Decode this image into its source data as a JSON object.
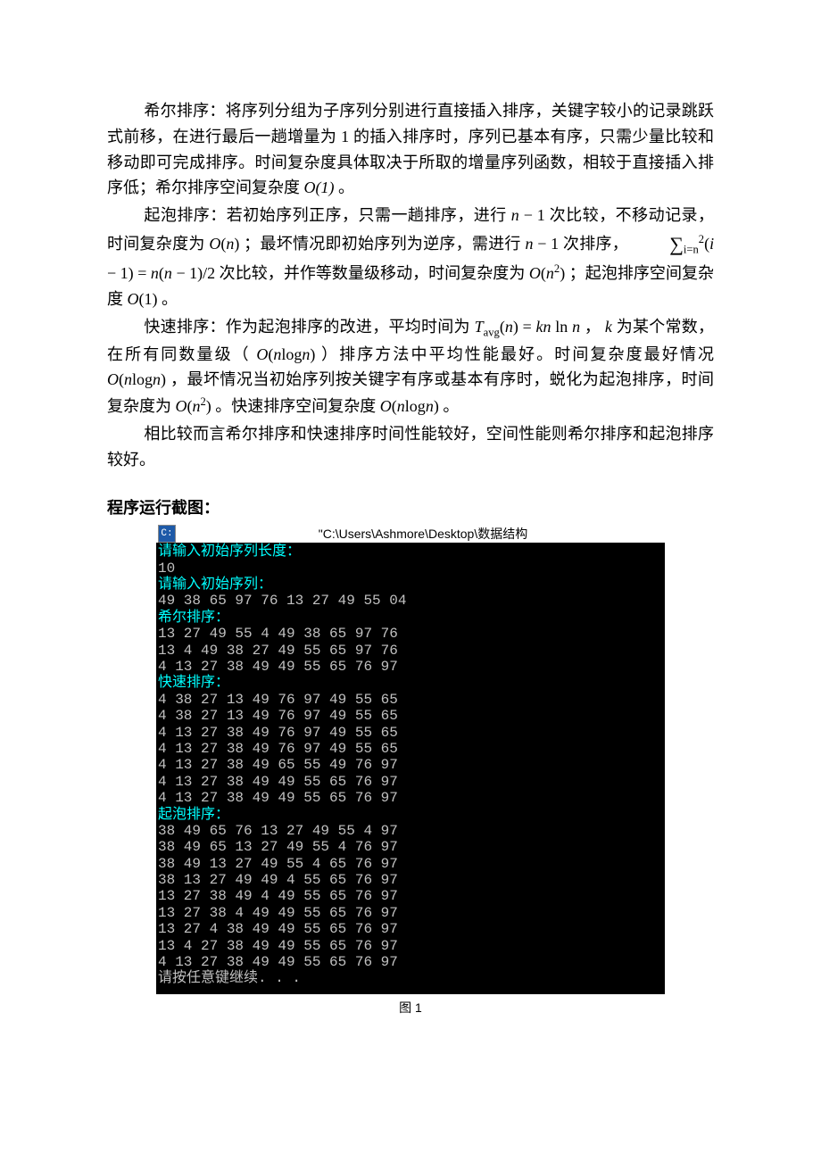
{
  "para1_a": "希尔排序：将序列分组为子序列分别进行直接插入排序，关键字较小的记录跳跃式前移，在进行最后一趟增量为 1 的插入排序时，序列已基本有序，只需少量比较和移动即可完成排序。时间复杂度具体取决于所取的增量序列函数，相较于直接插入排序低；希尔排序空间复杂度",
  "para1_b": "。",
  "para2_a": "起泡排序：若初始序列正序，只需一趟排序，进行",
  "para2_b": "次比较，不移动记录，时间复杂度为",
  "para2_c": "；最坏情况即初始序列为逆序，需进行",
  "para2_d": "次排序，",
  "para2_e": "次比较，并作等数量级移动，时间复杂度为",
  "para2_f": "；起泡排序空间复杂度",
  "para2_g": "。",
  "para3_a": "快速排序：作为起泡排序的改进，平均时间为",
  "para3_b": "，",
  "para3_c": " 为某个常数，在所有同数量级（",
  "para3_d": "）排序方法中平均性能最好。时间复杂度最好情况",
  "para3_e": "，最坏情况当初始序列按关键字有序或基本有序时，蜕化为起泡排序，时间复杂度为",
  "para3_f": "。快速排序空间复杂度",
  "para3_g": "。",
  "para4": "相比较而言希尔排序和快速排序时间性能较好，空间性能则希尔排序和起泡排序较好。",
  "section_label": "程序运行截图：",
  "caption": "图  1",
  "formula": {
    "O1": "O(1)",
    "n_minus_1": "n − 1",
    "On": "O(n)",
    "sum_expr": "(i − 1) = n(n − 1)/2",
    "sum_upper": "2",
    "sum_lower": "i=n",
    "On2": "O(n²)",
    "Tavg": "Tₐᵥg(n) = kn ln n",
    "k": "k",
    "Onlogn": "O(n log n)"
  },
  "console": {
    "title": "\"C:\\Users\\Ashmore\\Desktop\\数据结构",
    "lines": [
      {
        "t": "请输入初始序列长度：",
        "c": "cyan"
      },
      {
        "t": "10",
        "c": ""
      },
      {
        "t": "请输入初始序列：",
        "c": "cyan"
      },
      {
        "t": "49 38 65 97 76 13 27 49 55 04",
        "c": ""
      },
      {
        "t": "希尔排序：",
        "c": "cyan"
      },
      {
        "t": "13 27 49 55 4 49 38 65 97 76",
        "c": ""
      },
      {
        "t": "13 4 49 38 27 49 55 65 97 76",
        "c": ""
      },
      {
        "t": "4 13 27 38 49 49 55 65 76 97",
        "c": ""
      },
      {
        "t": "快速排序：",
        "c": "cyan"
      },
      {
        "t": "4 38 27 13 49 76 97 49 55 65",
        "c": ""
      },
      {
        "t": "4 38 27 13 49 76 97 49 55 65",
        "c": ""
      },
      {
        "t": "4 13 27 38 49 76 97 49 55 65",
        "c": ""
      },
      {
        "t": "4 13 27 38 49 76 97 49 55 65",
        "c": ""
      },
      {
        "t": "4 13 27 38 49 65 55 49 76 97",
        "c": ""
      },
      {
        "t": "4 13 27 38 49 49 55 65 76 97",
        "c": ""
      },
      {
        "t": "4 13 27 38 49 49 55 65 76 97",
        "c": ""
      },
      {
        "t": "起泡排序：",
        "c": "cyan"
      },
      {
        "t": "38 49 65 76 13 27 49 55 4 97",
        "c": ""
      },
      {
        "t": "38 49 65 13 27 49 55 4 76 97",
        "c": ""
      },
      {
        "t": "38 49 13 27 49 55 4 65 76 97",
        "c": ""
      },
      {
        "t": "38 13 27 49 49 4 55 65 76 97",
        "c": ""
      },
      {
        "t": "13 27 38 49 4 49 55 65 76 97",
        "c": ""
      },
      {
        "t": "13 27 38 4 49 49 55 65 76 97",
        "c": ""
      },
      {
        "t": "13 27 4 38 49 49 55 65 76 97",
        "c": ""
      },
      {
        "t": "13 4 27 38 49 49 55 65 76 97",
        "c": ""
      },
      {
        "t": "4 13 27 38 49 49 55 65 76 97",
        "c": ""
      },
      {
        "t": "请按任意键继续. . .",
        "c": ""
      }
    ]
  }
}
